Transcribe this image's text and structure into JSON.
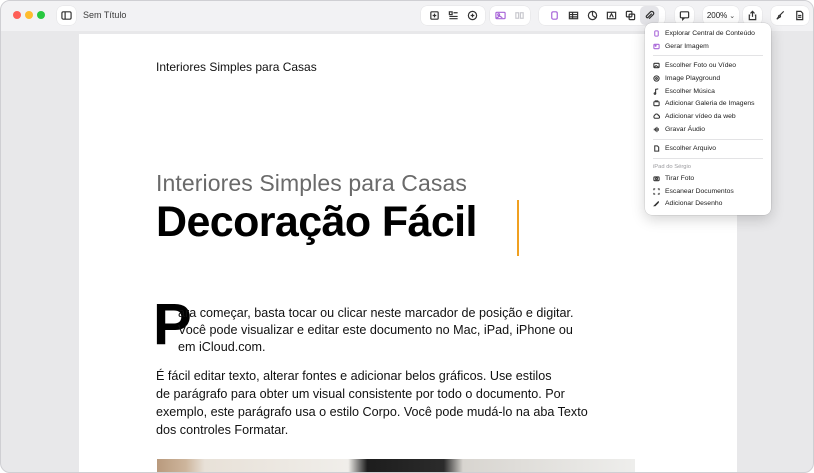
{
  "window": {
    "title": "Sem Título"
  },
  "toolbar": {
    "zoom": "200%",
    "buttons": [
      "sidebar-icon",
      "add-page-icon",
      "text-format-icon",
      "sparkle-icon",
      "media-icon",
      "shape-icon",
      "table-icon",
      "chart-icon",
      "textbox-icon",
      "shapes-icon",
      "attachment-icon",
      "comment-icon",
      "share-icon",
      "format-icon",
      "document-icon"
    ]
  },
  "document": {
    "header": "Interiores Simples para Casas",
    "subtitle": "Interiores Simples para Casas",
    "title": "Decoração Fácil",
    "dropcap": "P",
    "para1": [
      "ara começar, basta tocar ou clicar neste marcador de posição e digitar.",
      "Você pode visualizar e editar este documento no Mac, iPad, iPhone ou",
      "em iCloud.com."
    ],
    "para2": [
      "É fácil editar texto, alterar fontes e adicionar belos gráficos. Use estilos",
      "de parágrafo para obter um visual consistente por todo o documento. Por",
      "exemplo, este parágrafo usa o estilo Corpo. Você pode mudá-lo na aba Texto",
      "dos controles Formatar."
    ]
  },
  "menu": {
    "group1": [
      {
        "label": "Explorar Central de Conteúdo",
        "icon": "content-hub-icon"
      },
      {
        "label": "Gerar Imagem",
        "icon": "generate-image-icon"
      }
    ],
    "group2": [
      {
        "label": "Escolher Foto ou Vídeo",
        "icon": "photo-icon"
      },
      {
        "label": "Image Playground",
        "icon": "playground-icon"
      },
      {
        "label": "Escolher Música",
        "icon": "music-icon"
      },
      {
        "label": "Adicionar Galeria de Imagens",
        "icon": "gallery-icon"
      },
      {
        "label": "Adicionar vídeo da web",
        "icon": "web-video-icon"
      },
      {
        "label": "Gravar Áudio",
        "icon": "audio-icon"
      }
    ],
    "group3": [
      {
        "label": "Escolher Arquivo",
        "icon": "file-icon"
      }
    ],
    "device_label": "iPad do Sérgio",
    "group4": [
      {
        "label": "Tirar Foto",
        "icon": "camera-icon"
      },
      {
        "label": "Escanear Documentos",
        "icon": "scan-icon"
      },
      {
        "label": "Adicionar Desenho",
        "icon": "drawing-icon"
      }
    ]
  }
}
